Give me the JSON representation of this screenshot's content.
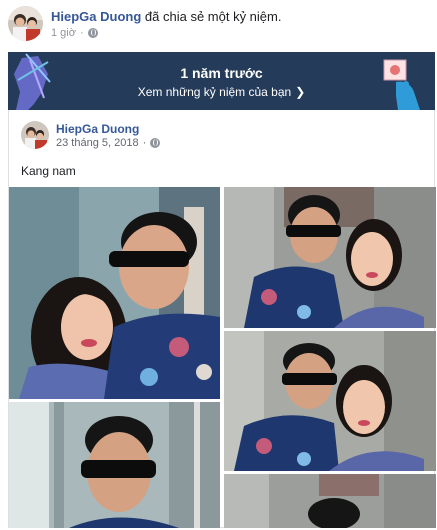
{
  "header": {
    "author": "HiepGa Duong",
    "action": "đã chia sẻ một kỷ niệm.",
    "time": "1 giờ",
    "privacy_icon": "globe-icon"
  },
  "banner": {
    "title": "1 năm trước",
    "link": "Xem những kỷ niệm của bạn",
    "chevron_icon": "chevron-right-icon",
    "bg_color": "#253b5a"
  },
  "shared_post": {
    "author": "HiepGa Duong",
    "date": "23 tháng 5, 2018",
    "privacy_icon": "globe-icon",
    "caption": "Kang nam"
  },
  "photos": [
    {
      "description": "selfie-couple-1"
    },
    {
      "description": "selfie-couple-2"
    },
    {
      "description": "selfie-couple-3"
    },
    {
      "description": "selfie-man-4"
    },
    {
      "description": "selfie-5"
    }
  ],
  "colors": {
    "link": "#365899",
    "meta": "#90949c"
  }
}
